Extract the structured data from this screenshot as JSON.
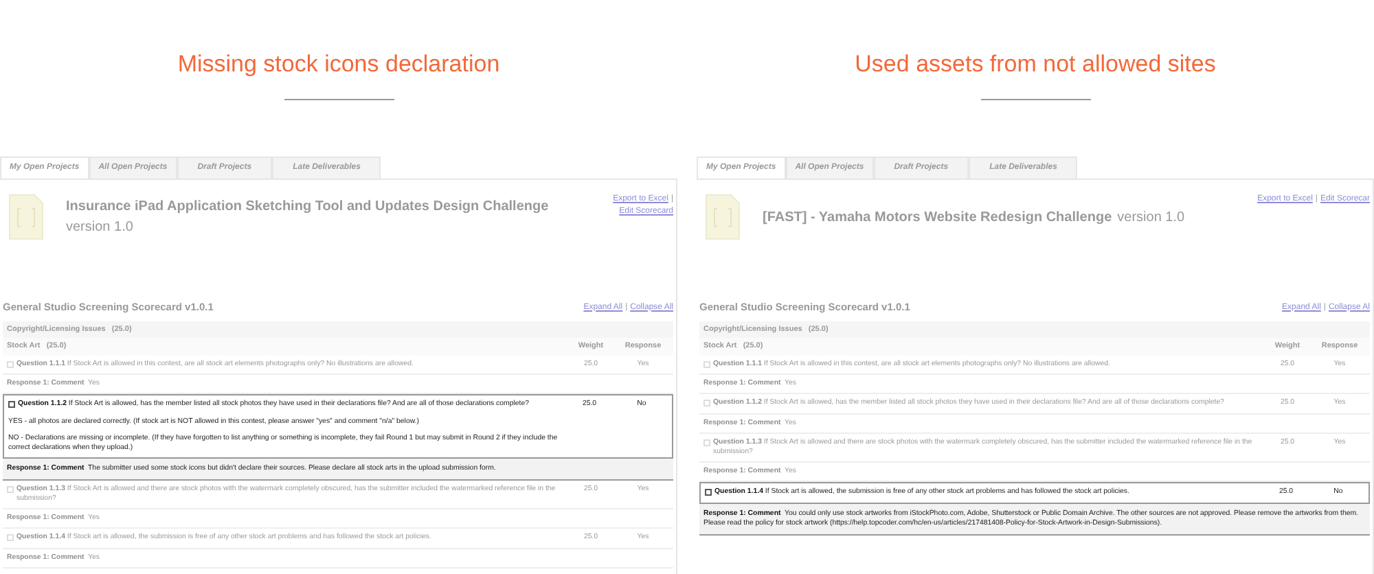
{
  "panels": [
    {
      "heading": "Missing stock icons declaration",
      "tabs": [
        {
          "label": "My Open Projects",
          "selected": true
        },
        {
          "label": "All Open Projects",
          "selected": false
        },
        {
          "label": "Draft Projects",
          "selected": false
        },
        {
          "label": "Late Deliverables",
          "selected": false
        }
      ],
      "project_title": "Insurance iPad Application Sketching Tool and Updates Design Challenge",
      "version": "version 1.0",
      "version_inline": false,
      "links": [
        "Export to Excel",
        "Edit Scorecard"
      ],
      "separator": "|",
      "scorecard_title": "General Studio Screening Scorecard v1.0.1",
      "toggle_links": [
        "Expand All",
        "Collapse All"
      ],
      "section": "Copyright/Licensing Issues   (25.0)",
      "group": "Stock Art   (25.0)",
      "columns": [
        "Weight",
        "Response"
      ],
      "questions": [
        {
          "label": "Question 1.1.1",
          "text": "If Stock Art is allowed in this contest, are all stock art elements photographs only? No illustrations are allowed.",
          "weight": "25.0",
          "response": "Yes",
          "highlighted": false,
          "comment_label": "Response 1: Comment",
          "comment": "Yes"
        },
        {
          "label": "Question 1.1.2",
          "text": "If Stock Art is allowed, has the member listed all stock photos they have used in their declarations file? And are all of those declarations complete?",
          "weight": "25.0",
          "response": "No",
          "highlighted": true,
          "details": [
            "YES - all photos are declared correctly. (If stock art is NOT allowed in this contest, please answer \"yes\" and comment \"n/a\" below.)",
            "NO - Declarations are missing or incomplete. (If they have forgotten to list anything or something is incomplete, they fail Round 1 but may submit in Round 2 if they include the correct declarations when they upload.)"
          ],
          "comment_label": "Response 1: Comment",
          "comment": "The submitter used some stock icons but didn't declare their sources. Please declare all stock arts in the upload submission form."
        },
        {
          "label": "Question 1.1.3",
          "text": "If Stock Art is allowed and there are stock photos with the watermark completely obscured, has the submitter included the watermarked reference file in the submission?",
          "weight": "25.0",
          "response": "Yes",
          "highlighted": false,
          "comment_label": "Response 1: Comment",
          "comment": "Yes"
        },
        {
          "label": "Question 1.1.4",
          "text": "If Stock art is allowed, the submission is free of any other stock art problems and has followed the stock art policies.",
          "weight": "25.0",
          "response": "Yes",
          "highlighted": false,
          "comment_label": "Response 1: Comment",
          "comment": "Yes"
        }
      ]
    },
    {
      "heading": "Used assets from not allowed sites",
      "tabs": [
        {
          "label": "My Open Projects",
          "selected": true
        },
        {
          "label": "All Open Projects",
          "selected": false
        },
        {
          "label": "Draft Projects",
          "selected": false
        },
        {
          "label": "Late Deliverables",
          "selected": false
        }
      ],
      "project_title": "[FAST] - Yamaha Motors Website Redesign Challenge",
      "version": "version 1.0",
      "version_inline": true,
      "links": [
        "Export to Excel",
        "Edit Scorecar"
      ],
      "separator": "|",
      "scorecard_title": "General Studio Screening Scorecard v1.0.1",
      "toggle_links": [
        "Expand All",
        "Collapse Al"
      ],
      "section": "Copyright/Licensing Issues   (25.0)",
      "group": "Stock Art   (25.0)",
      "columns": [
        "Weight",
        "Response"
      ],
      "questions": [
        {
          "label": "Question 1.1.1",
          "text": "If Stock Art is allowed in this contest, are all stock art elements photographs only? No illustrations are allowed.",
          "weight": "25.0",
          "response": "Yes",
          "highlighted": false,
          "comment_label": "Response 1: Comment",
          "comment": "Yes"
        },
        {
          "label": "Question 1.1.2",
          "text": "If Stock Art is allowed, has the member listed all stock photos they have used in their declarations file? And are all of those declarations complete?",
          "weight": "25.0",
          "response": "Yes",
          "highlighted": false,
          "comment_label": "Response 1: Comment",
          "comment": "Yes"
        },
        {
          "label": "Question 1.1.3",
          "text": "If Stock Art is allowed and there are stock photos with the watermark completely obscured, has the submitter included the watermarked reference file in the submission?",
          "weight": "25.0",
          "response": "Yes",
          "highlighted": false,
          "comment_label": "Response 1: Comment",
          "comment": "Yes"
        },
        {
          "label": "Question 1.1.4",
          "text": "If Stock art is allowed, the submission is free of any other stock art problems and has followed the stock art policies.",
          "weight": "25.0",
          "response": "No",
          "highlighted": true,
          "comment_label": "Response 1: Comment",
          "comment": "You could only use stock artworks from iStockPhoto.com, Adobe, Shutterstock or Public Domain Archive. The other sources are not approved. Please remove the artworks from them. Please read the policy for stock artwork (https://help.topcoder.com/hc/en-us/articles/217481408-Policy-for-Stock-Artwork-in-Design-Submissions)."
        }
      ]
    }
  ]
}
